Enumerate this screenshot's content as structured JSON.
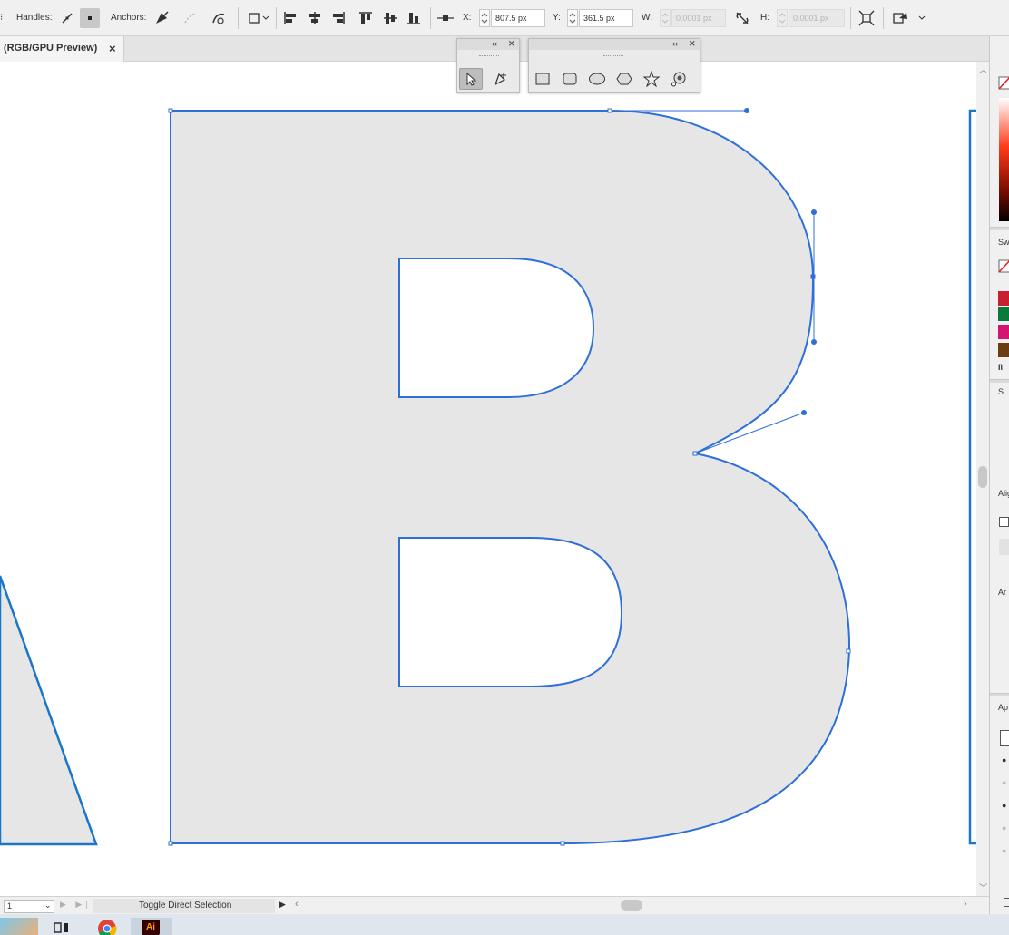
{
  "control_bar": {
    "handles_label": "Handles:",
    "anchors_label": "Anchors:",
    "x_label": "X:",
    "x_value": "807.5 px",
    "y_label": "Y:",
    "y_value": "361.5 px",
    "w_label": "W:",
    "w_value": "0.0001 px",
    "h_label": "H:",
    "h_value": "0.0001 px"
  },
  "document_tab": {
    "title": "(RGB/GPU Preview)",
    "close_glyph": "×"
  },
  "status_bar": {
    "page_value": "1",
    "status_text": "Toggle Direct Selection"
  },
  "right_dock": {
    "swatches_label": "Sw",
    "stroke_label": "S",
    "align_label": "Alig",
    "artboards_label": "Ar",
    "appearance_label": "Ap",
    "swatch_colors": [
      "#c8202f",
      "#0a7a3c",
      "#d4146e",
      "#6b3c10"
    ]
  },
  "colors": {
    "selection_blue": "#2e6fd8",
    "artboard_blue": "#1976c8",
    "shape_fill": "#e6e6e6",
    "ui_bg": "#f0f0f0",
    "ai_brand": "#330000",
    "ai_text": "#ff9a00"
  },
  "icons": {
    "taskbar": [
      "photo-app-icon",
      "snipping-tool-icon",
      "chrome-icon",
      "illustrator-icon"
    ],
    "floating_tools": [
      "selection-tool-icon",
      "add-anchor-point-icon",
      "rectangle-tool-icon",
      "rounded-rectangle-tool-icon",
      "ellipse-tool-icon",
      "polygon-tool-icon",
      "star-tool-icon",
      "flare-tool-icon"
    ]
  }
}
